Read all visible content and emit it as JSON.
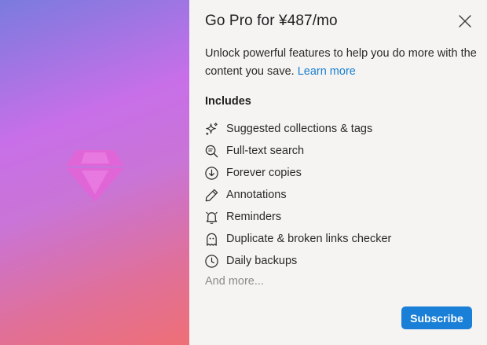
{
  "dialog": {
    "title": "Go Pro for ¥487/mo",
    "description": "Unlock powerful features to help you do more with the content you save. ",
    "learn_more": "Learn more",
    "includes_label": "Includes",
    "features": [
      {
        "label": "Suggested collections & tags",
        "icon": "sparkle-icon"
      },
      {
        "label": "Full-text search",
        "icon": "search-text-icon"
      },
      {
        "label": "Forever copies",
        "icon": "cloud-download-icon"
      },
      {
        "label": "Annotations",
        "icon": "pencil-icon"
      },
      {
        "label": "Reminders",
        "icon": "bell-icon"
      },
      {
        "label": "Duplicate & broken links checker",
        "icon": "ghost-icon"
      },
      {
        "label": "Daily backups",
        "icon": "clock-icon"
      }
    ],
    "more": "And more...",
    "subscribe_label": "Subscribe"
  },
  "colors": {
    "accent": "#1a7fd6",
    "link": "#1a7fd0",
    "gem": "#e266d6"
  }
}
